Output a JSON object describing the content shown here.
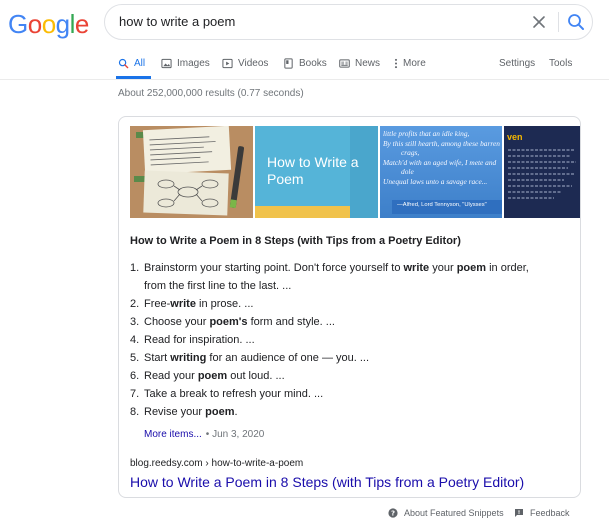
{
  "logo": {
    "letters": [
      "G",
      "o",
      "o",
      "g",
      "l",
      "e"
    ],
    "colors": [
      "#4285f4",
      "#ea4335",
      "#fbbc05",
      "#4285f4",
      "#34a853",
      "#ea4335"
    ]
  },
  "search": {
    "query": "how to write a poem"
  },
  "tabs": [
    {
      "label": "All",
      "icon": "search-icon"
    },
    {
      "label": "Images",
      "icon": "image-icon"
    },
    {
      "label": "Videos",
      "icon": "video-icon"
    },
    {
      "label": "Books",
      "icon": "book-icon"
    },
    {
      "label": "News",
      "icon": "news-icon"
    },
    {
      "label": "More",
      "icon": "more-vertical-icon"
    }
  ],
  "right_tabs": {
    "settings": "Settings",
    "tools": "Tools"
  },
  "stats": "About 252,000,000 results (0.77 seconds)",
  "thumbnails": {
    "t2_text": "How to Write a Poem",
    "t3_lines": [
      "little profits that an idle king,",
      "By this still hearth, among these barren",
      "crags,",
      "Match'd with an aged wife, I mete and",
      "dole",
      "Unequal laws unto a savage race..."
    ],
    "t3_attrib": "—Alfred, Lord Tennyson, \"Ulysses\"",
    "t4_text": "ven"
  },
  "snippet": {
    "title": "How to Write a Poem in 8 Steps (with Tips from a Poetry Editor)",
    "steps": [
      {
        "n": "1.",
        "parts": [
          {
            "t": "Brainstorm your starting point. Don't force yourself to ",
            "b": false
          },
          {
            "t": "write",
            "b": true
          },
          {
            "t": " your ",
            "b": false
          },
          {
            "t": "poem",
            "b": true
          },
          {
            "t": " in order,",
            "b": false
          }
        ],
        "cont": "from the first line to the last. ..."
      },
      {
        "n": "2.",
        "parts": [
          {
            "t": "Free-",
            "b": false
          },
          {
            "t": "write",
            "b": true
          },
          {
            "t": " in prose. ...",
            "b": false
          }
        ]
      },
      {
        "n": "3.",
        "parts": [
          {
            "t": "Choose your ",
            "b": false
          },
          {
            "t": "poem's",
            "b": true
          },
          {
            "t": " form and style. ...",
            "b": false
          }
        ]
      },
      {
        "n": "4.",
        "parts": [
          {
            "t": "Read for inspiration. ...",
            "b": false
          }
        ]
      },
      {
        "n": "5.",
        "parts": [
          {
            "t": "Start ",
            "b": false
          },
          {
            "t": "writing",
            "b": true
          },
          {
            "t": " for an audience of one — you. ...",
            "b": false
          }
        ]
      },
      {
        "n": "6.",
        "parts": [
          {
            "t": "Read your ",
            "b": false
          },
          {
            "t": "poem",
            "b": true
          },
          {
            "t": " out loud. ...",
            "b": false
          }
        ]
      },
      {
        "n": "7.",
        "parts": [
          {
            "t": "Take a break to refresh your mind. ...",
            "b": false
          }
        ]
      },
      {
        "n": "8.",
        "parts": [
          {
            "t": "Revise your ",
            "b": false
          },
          {
            "t": "poem",
            "b": true
          },
          {
            "t": ".",
            "b": false
          }
        ]
      }
    ],
    "more_label": "More items...",
    "date": "• Jun 3, 2020",
    "cite": "blog.reedsy.com › how-to-write-a-poem",
    "link": "How to Write a Poem in 8 Steps (with Tips from a Poetry Editor)"
  },
  "footer": {
    "about": "About Featured Snippets",
    "feedback": "Feedback"
  },
  "colors": {
    "link": "#1a0dab",
    "accent": "#1a73e8",
    "muted": "#70757a"
  }
}
